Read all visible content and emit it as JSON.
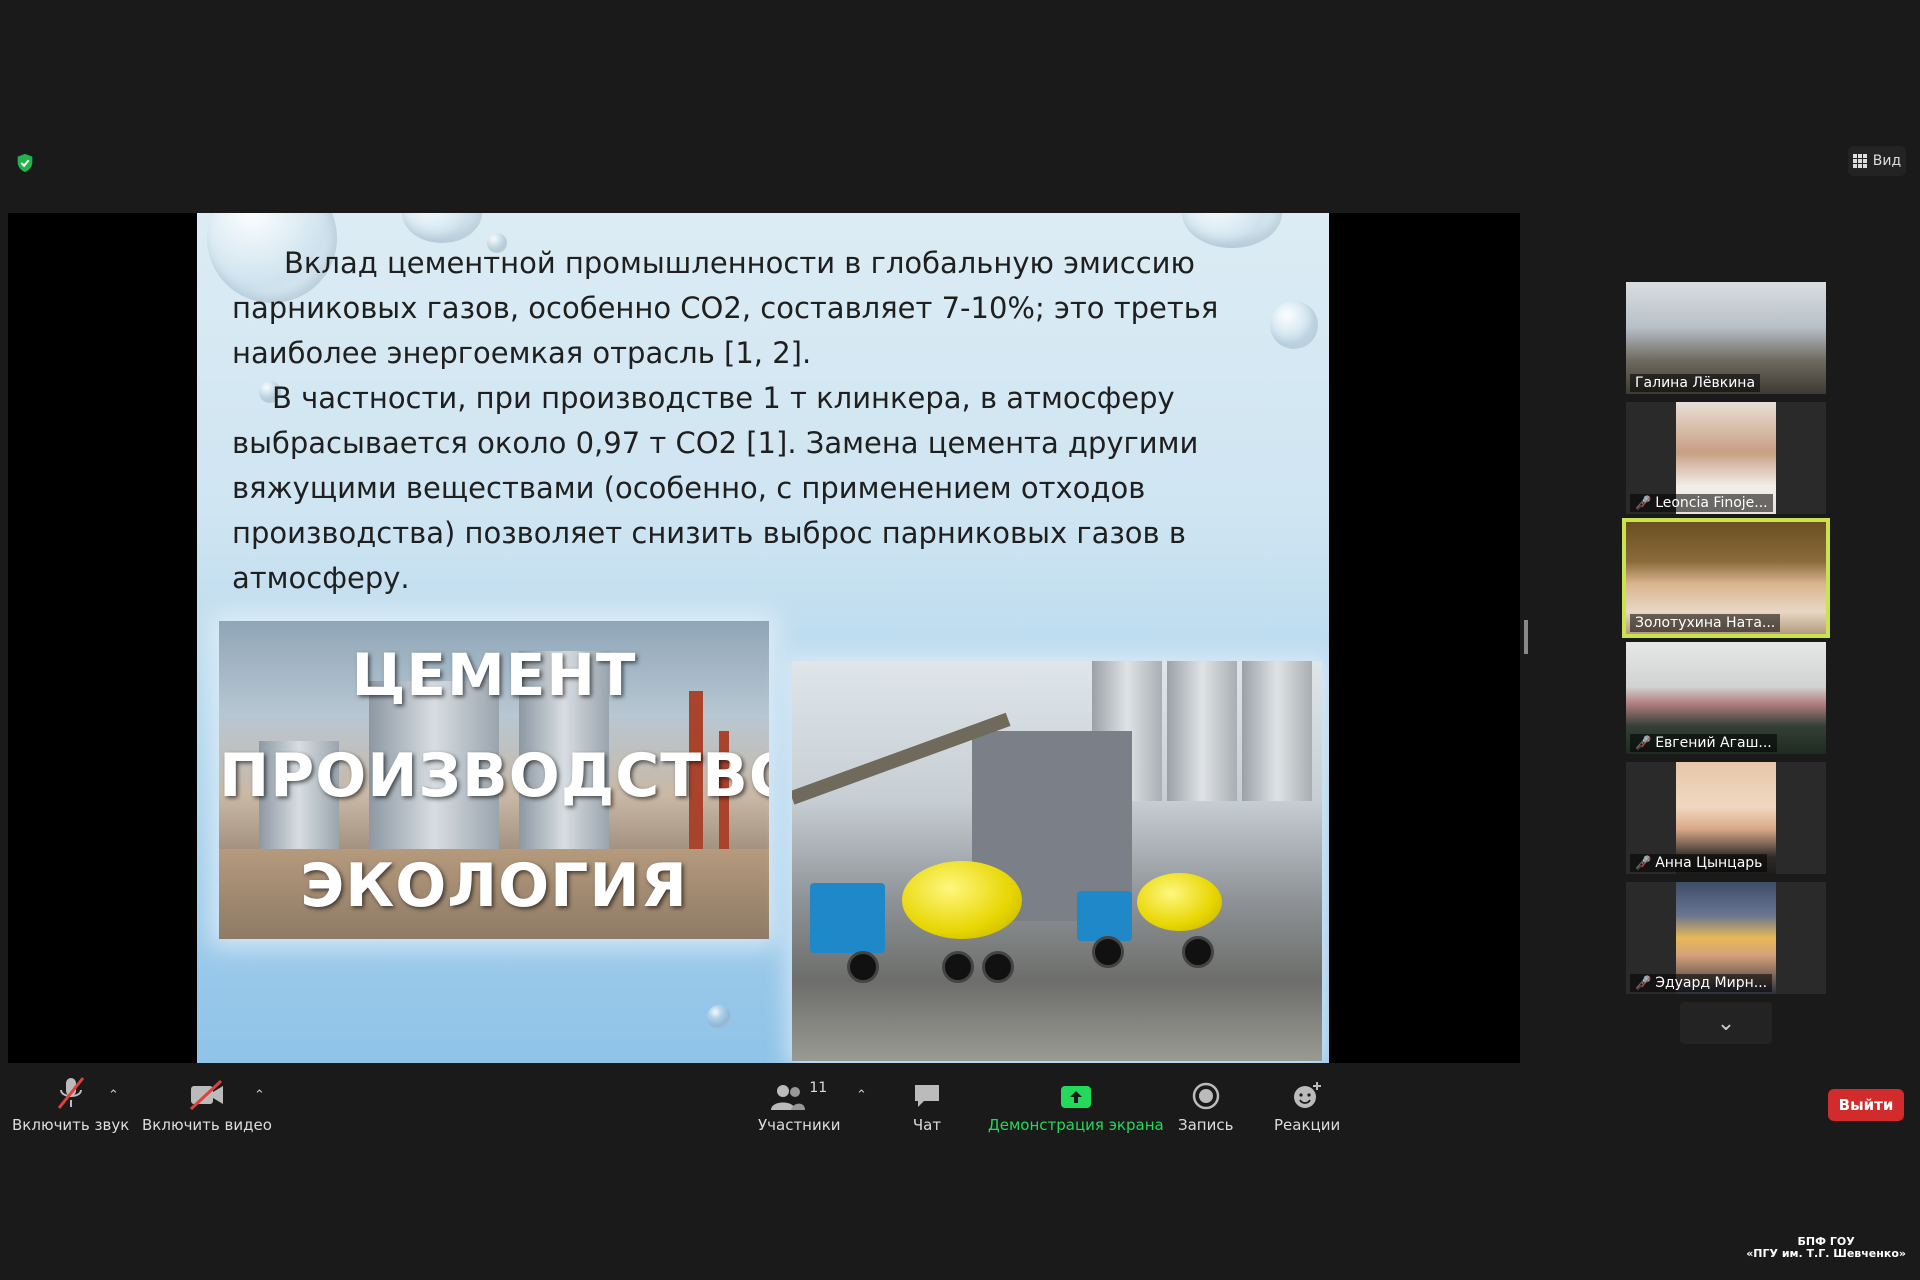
{
  "view_button": {
    "label": "Вид",
    "icon": "grid-icon"
  },
  "security_icon": "shield-check-icon",
  "slide": {
    "paragraph1": "Вклад цементной промышленности в глобальную эмиссию парниковых газов, особенно CO2, составляет 7-10%; это третья наиболее энергоемкая отрасль [1, 2].",
    "paragraph2": "В частности, при производстве 1 т клинкера, в атмосферу выбрасывается около 0,97 т CO2 [1]. Замена цемента другими вяжущими веществами (особенно, с применением отходов производства) позволяет снизить выброс парниковых газов в атмосферу.",
    "image_words": [
      "ЦЕМЕНТ",
      "ПРОИЗВОДСТВО",
      "ЭКОЛОГИЯ"
    ]
  },
  "participants": [
    {
      "name": "Галина Лёвкина",
      "muted": false,
      "active": false
    },
    {
      "name": "Leoncia Finoje...",
      "muted": true,
      "active": false
    },
    {
      "name": "Золотухина Ната...",
      "muted": false,
      "active": true
    },
    {
      "name": "Евгений Агаш...",
      "muted": true,
      "active": false
    },
    {
      "name": "Анна Цынцарь",
      "muted": true,
      "active": false
    },
    {
      "name": "Эдуард Мирн...",
      "muted": true,
      "active": false
    }
  ],
  "toolbar": {
    "audio": "Включить звук",
    "video": "Включить видео",
    "participants": "Участники",
    "participants_count": "11",
    "chat": "Чат",
    "share": "Демонстрация экрана",
    "record": "Запись",
    "reactions": "Реакции",
    "leave": "Выйти"
  },
  "watermark": {
    "line1": "БПФ ГОУ",
    "line2": "«ПГУ им. Т.Г. Шевченко»"
  },
  "colors": {
    "share_green": "#23d959",
    "leave_red": "#d12b2b",
    "active_border": "#c9e34e",
    "muted_red": "#e0403b"
  }
}
